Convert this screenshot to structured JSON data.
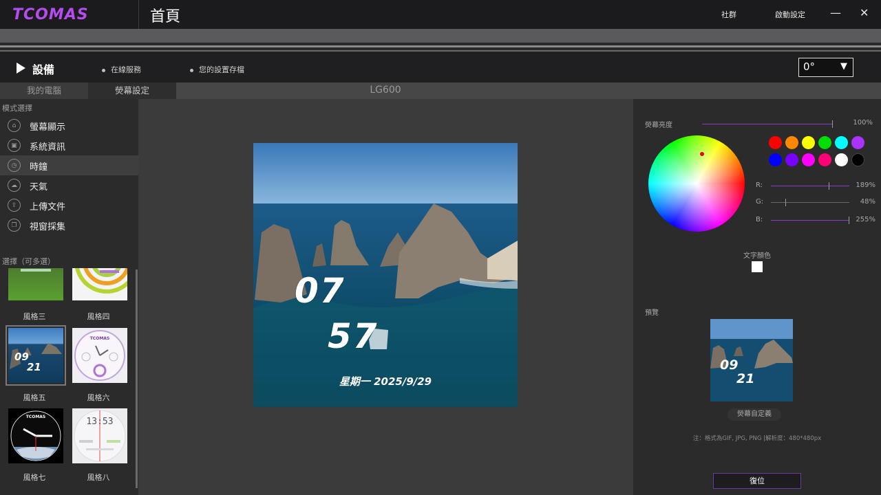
{
  "app": {
    "logo": "TCOMAS",
    "page_title": "首頁",
    "community": "社群",
    "startup_settings": "啟動設定",
    "minimize": "—",
    "close": "✕"
  },
  "device_header": {
    "title": "設備",
    "online_service": "在線服務",
    "saved_settings": "您的設置存檔",
    "rotation": "0°"
  },
  "tabs": {
    "my_computer": "我的電腦",
    "screen_settings": "熒幕設定",
    "device_name": "LG600"
  },
  "left": {
    "mode_label": "模式選擇",
    "modes": [
      {
        "label": "螢幕顯示",
        "icon": "screen-display-icon"
      },
      {
        "label": "系統資訊",
        "icon": "system-info-icon"
      },
      {
        "label": "時鐘",
        "icon": "clock-icon"
      },
      {
        "label": "天氣",
        "icon": "weather-icon"
      },
      {
        "label": "上傳文件",
        "icon": "upload-icon"
      },
      {
        "label": "視窗採集",
        "icon": "window-capture-icon"
      }
    ],
    "multi_select_label": "選擇（可多選）",
    "styles": [
      "風格三",
      "風格四",
      "風格五",
      "風格六",
      "風格七",
      "風格八"
    ],
    "thumb_texts": {
      "style5_hour": "09",
      "style5_min": "21",
      "style6_brand": "TCOMAS",
      "style7_brand": "TCOMAS",
      "style8_time": "13:53"
    }
  },
  "clock": {
    "hour": "07",
    "minute": "57",
    "date": "星期一 2025/9/29"
  },
  "right": {
    "brightness_label": "熒幕亮度",
    "brightness_pct": "100%",
    "r_label": "R:",
    "g_label": "G:",
    "b_label": "B:",
    "r_value": "189%",
    "g_value": "48%",
    "b_value": "255%",
    "text_color_label": "文字顏色",
    "preview_label": "預覽",
    "preview_hour": "09",
    "preview_min": "21",
    "custom_button": "熒幕自定義",
    "note": "注：格式為GIF, JPG, PNG |解析度：480*480px",
    "reset_button": "復位"
  },
  "colors": {
    "accent": "#b54cf0",
    "swatches": [
      "#ff0000",
      "#ff8800",
      "#ffff00",
      "#00dd00",
      "#00ffff",
      "#aa33ff",
      "#0000ff",
      "#7a00ff",
      "#ff00ff",
      "#ff0077",
      "#ffffff",
      "#000000"
    ]
  }
}
